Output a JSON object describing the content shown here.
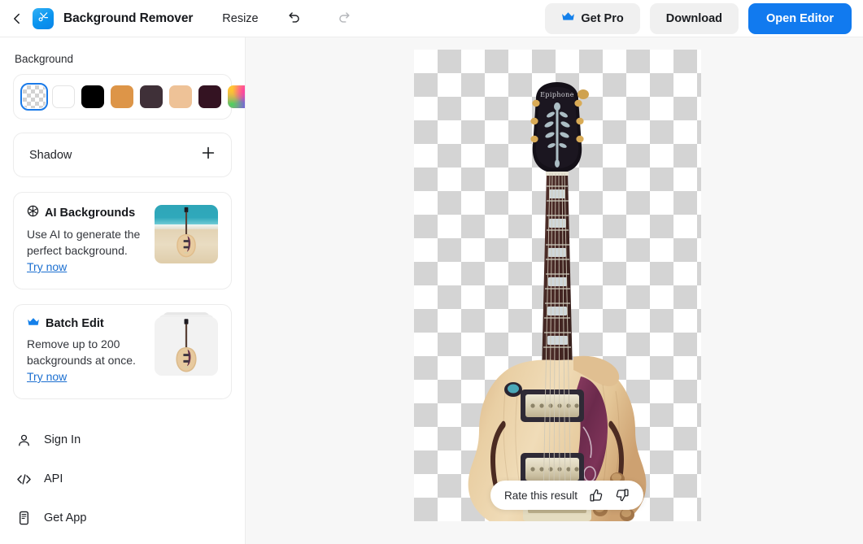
{
  "header": {
    "back_icon": "chevron-left-icon",
    "logo_icon": "scissors-logo-icon",
    "app_title": "Background Remover",
    "resize_label": "Resize",
    "undo_icon": "undo-icon",
    "redo_icon": "redo-icon",
    "get_pro_label": "Get Pro",
    "get_pro_icon": "crown-icon",
    "download_label": "Download",
    "open_editor_label": "Open Editor",
    "accent_color": "#117aef",
    "button_grey": "#f0f0f0"
  },
  "sidebar": {
    "background_section": {
      "title": "Background",
      "swatches": [
        {
          "name": "transparent",
          "color": "transparent",
          "selected": true
        },
        {
          "name": "white",
          "color": "#ffffff",
          "selected": false
        },
        {
          "name": "black",
          "color": "#000000",
          "selected": false
        },
        {
          "name": "orange",
          "color": "#dd9548",
          "selected": false
        },
        {
          "name": "dark-plum",
          "color": "#3f3038",
          "selected": false
        },
        {
          "name": "tan",
          "color": "#eec297",
          "selected": false
        },
        {
          "name": "deep-maroon",
          "color": "#341322",
          "selected": false
        },
        {
          "name": "rainbow",
          "color": "gradient",
          "selected": false
        }
      ]
    },
    "shadow_section": {
      "label": "Shadow",
      "add_icon": "plus-icon"
    },
    "promos": [
      {
        "icon": "aperture-icon",
        "title": "AI Backgrounds",
        "description": "Use AI to generate the perfect background.",
        "link": "Try now",
        "thumb": "beach-guitar-thumbnail"
      },
      {
        "icon": "crown-icon",
        "title": "Batch Edit",
        "description": "Remove up to 200 backgrounds at once.",
        "link": "Try now",
        "thumb": "stacked-guitar-thumbnail"
      }
    ],
    "nav": [
      {
        "icon": "user-icon",
        "label": "Sign In"
      },
      {
        "icon": "code-icon",
        "label": "API"
      },
      {
        "icon": "phone-icon",
        "label": "Get App"
      }
    ]
  },
  "canvas": {
    "image_alt": "electric-guitar-cutout",
    "rate": {
      "label": "Rate this result",
      "thumbs_up_icon": "thumbs-up-icon",
      "thumbs_down_icon": "thumbs-down-icon"
    }
  }
}
